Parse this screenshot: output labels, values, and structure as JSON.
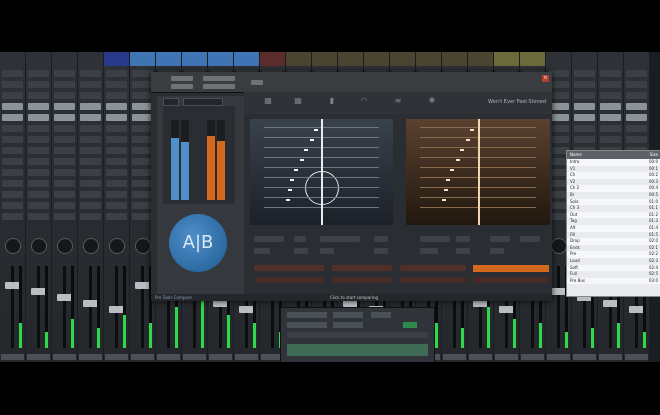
{
  "plugin": {
    "song_title": "Won't Ever Feel Stoned",
    "toolbar_icons": [
      "grid-icon",
      "grid-icon",
      "bars-icon",
      "wifi-icon",
      "sliders-icon",
      "gear-icon"
    ],
    "ab_label": "A|B",
    "status_text": "Pro Tools Compare"
  },
  "mini_window": {
    "caption": "Click to start comparing"
  },
  "right_list": {
    "headers": [
      "Name",
      "Size"
    ],
    "items": [
      {
        "name": "Intro",
        "size": "00:0"
      },
      {
        "name": "V1",
        "size": "00:1"
      },
      {
        "name": "Ch",
        "size": "00:2"
      },
      {
        "name": "V2",
        "size": "00:3"
      },
      {
        "name": "Ch 2",
        "size": "00:4"
      },
      {
        "name": "Br",
        "size": "00:5"
      },
      {
        "name": "Solo",
        "size": "01:0"
      },
      {
        "name": "Ch 3",
        "size": "01:1"
      },
      {
        "name": "Out",
        "size": "01:2"
      },
      {
        "name": "Tag",
        "size": "01:3"
      },
      {
        "name": "Alt",
        "size": "01:4"
      },
      {
        "name": "Fill",
        "size": "01:5"
      },
      {
        "name": "Drop",
        "size": "02:0"
      },
      {
        "name": "Ends",
        "size": "02:1"
      },
      {
        "name": "Pre",
        "size": "02:2"
      },
      {
        "name": "Loud",
        "size": "02:3"
      },
      {
        "name": "Soft",
        "size": "02:4"
      },
      {
        "name": "Full",
        "size": "02:5"
      },
      {
        "name": "Pre Bus",
        "size": "03:0"
      }
    ]
  },
  "colors": {
    "blue": "#4f8fc9",
    "orange": "#d3691d",
    "meter_green": "#2fd84a"
  },
  "meters": {
    "left_a": 0.78,
    "left_b": 0.72,
    "right_a": 0.8,
    "right_b": 0.74
  }
}
